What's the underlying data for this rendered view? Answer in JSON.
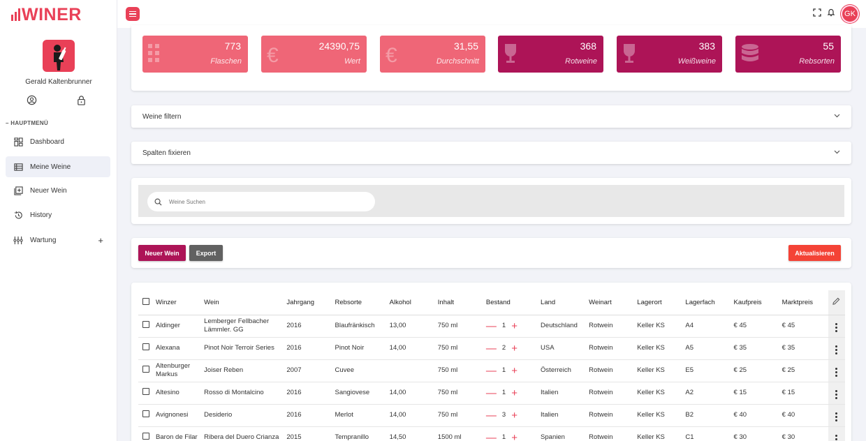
{
  "app": {
    "logo_text": "WINER",
    "user_name": "Gerald Kaltenbrunner",
    "avatar_initials": "GK"
  },
  "sidebar": {
    "menu_heading": "– HAUPTMENÜ",
    "items": [
      {
        "label": "Dashboard",
        "icon": "dashboard-icon"
      },
      {
        "label": "Meine Weine",
        "icon": "list-icon",
        "active": true
      },
      {
        "label": "Neuer Wein",
        "icon": "add-box-icon"
      },
      {
        "label": "History",
        "icon": "history-icon"
      },
      {
        "label": "Wartung",
        "icon": "tune-icon",
        "expand": "+"
      }
    ]
  },
  "stats": [
    {
      "value": "773",
      "label": "Flaschen",
      "color": "#ef6677",
      "icon": "grid-icon"
    },
    {
      "value": "24390,75",
      "label": "Wert",
      "color": "#ef6677",
      "icon": "euro-icon"
    },
    {
      "value": "31,55",
      "label": "Durchschnitt",
      "color": "#ef6677",
      "icon": "euro-icon"
    },
    {
      "value": "368",
      "label": "Rotweine",
      "color": "#ad1457",
      "icon": "wine-glass-icon"
    },
    {
      "value": "383",
      "label": "Weißweine",
      "color": "#ad1457",
      "icon": "wine-glass-icon"
    },
    {
      "value": "55",
      "label": "Rebsorten",
      "color": "#ad1457",
      "icon": "database-icon"
    }
  ],
  "panels": {
    "filter_label": "Weine filtern",
    "fix_columns_label": "Spalten fixieren"
  },
  "search": {
    "placeholder": "Weine Suchen"
  },
  "buttons": {
    "new_wine": "Neuer Wein",
    "export": "Export",
    "refresh": "Aktualisieren"
  },
  "colors": {
    "accent": "#e94057",
    "primary_dark": "#ad1457",
    "export_grey": "#616161",
    "refresh_red": "#f44336"
  },
  "table": {
    "headers": [
      "Winzer",
      "Wein",
      "Jahrgang",
      "Rebsorte",
      "Alkohol",
      "Inhalt",
      "Bestand",
      "Land",
      "Weinart",
      "Lagerort",
      "Lagerfach",
      "Kaufpreis",
      "Marktpreis"
    ],
    "rows": [
      [
        "Aldinger",
        "Lemberger Fellbacher Lämmler. GG",
        "2016",
        "Blaufränkisch",
        "13,00",
        "750 ml",
        "1",
        "Deutschland",
        "Rotwein",
        "Keller KS",
        "A4",
        "€ 45",
        "€ 45"
      ],
      [
        "Alexana",
        "Pinot Noir Terroir Series",
        "2016",
        "Pinot Noir",
        "14,00",
        "750 ml",
        "2",
        "USA",
        "Rotwein",
        "Keller KS",
        "A5",
        "€ 35",
        "€ 35"
      ],
      [
        "Altenburger Markus",
        "Joiser Reben",
        "2007",
        "Cuvee",
        "",
        "750 ml",
        "1",
        "Österreich",
        "Rotwein",
        "Keller KS",
        "E5",
        "€ 25",
        "€ 25"
      ],
      [
        "Altesino",
        "Rosso di Montalcino",
        "2016",
        "Sangiovese",
        "14,00",
        "750 ml",
        "1",
        "Italien",
        "Rotwein",
        "Keller KS",
        "A2",
        "€ 15",
        "€ 15"
      ],
      [
        "Avignonesi",
        "Desiderio",
        "2016",
        "Merlot",
        "14,00",
        "750 ml",
        "3",
        "Italien",
        "Rotwein",
        "Keller KS",
        "B2",
        "€ 40",
        "€ 40"
      ],
      [
        "Baron de Filar",
        "Ribera del Duero Crianza",
        "2015",
        "Tempranillo",
        "14,50",
        "1500 ml",
        "1",
        "Spanien",
        "Rotwein",
        "Keller KS",
        "C1",
        "€ 30",
        "€ 30"
      ]
    ]
  }
}
